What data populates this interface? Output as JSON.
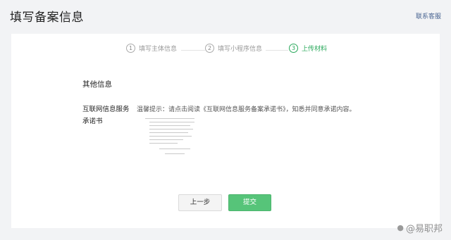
{
  "header": {
    "title": "填写备案信息",
    "contact": "联系客服"
  },
  "steps": [
    {
      "num": "1",
      "label": "填写主体信息",
      "active": false
    },
    {
      "num": "2",
      "label": "填写小程序信息",
      "active": false
    },
    {
      "num": "3",
      "label": "上传材料",
      "active": true
    }
  ],
  "section": {
    "title": "其他信息",
    "row_label": "互联网信息服务承诺书",
    "tip": "温馨提示：请点击阅读《互联网信息服务备案承诺书》，知悉并同意承诺内容。"
  },
  "buttons": {
    "prev": "上一步",
    "submit": "提交"
  },
  "watermark": {
    "icon": "paw-icon",
    "text": "@易职邦"
  },
  "colors": {
    "accent": "#28a85a",
    "submit_bg": "#56c479",
    "link": "#4a6592"
  }
}
